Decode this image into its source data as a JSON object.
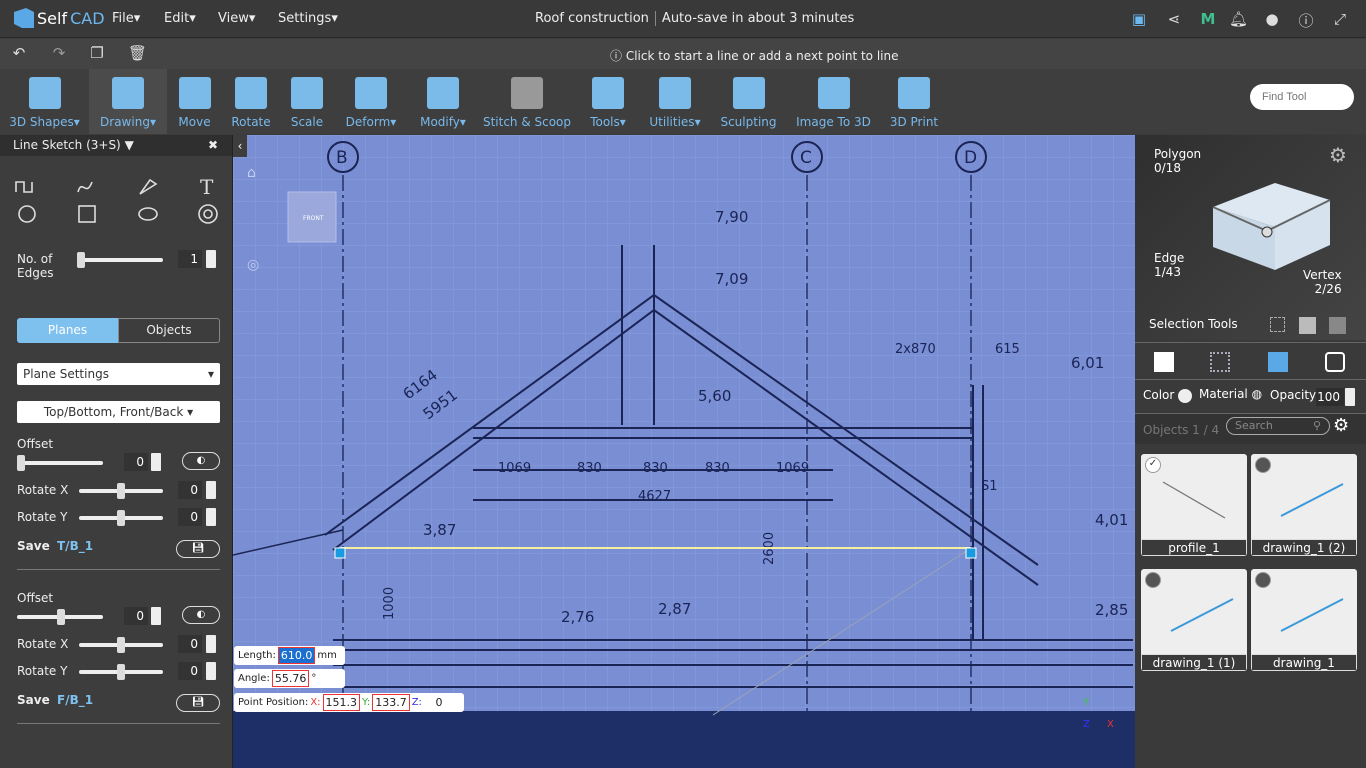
{
  "app": {
    "name_a": "Self",
    "name_b": "CAD",
    "menus": [
      "File",
      "Edit",
      "View",
      "Settings"
    ],
    "doc_title": "Roof construction",
    "autosave": "Auto-save in about 3 minutes"
  },
  "header_icons": [
    "save-icon",
    "share-icon",
    "m-icon",
    "bell-icon",
    "user-icon",
    "info-icon",
    "fullscreen-icon"
  ],
  "hint": "Click to start a line or add a next point to line",
  "toolbar": [
    {
      "label": "3D Shapes",
      "dropdown": true
    },
    {
      "label": "Drawing",
      "dropdown": true,
      "active": true
    },
    {
      "label": "Move"
    },
    {
      "label": "Rotate"
    },
    {
      "label": "Scale"
    },
    {
      "label": "Deform",
      "dropdown": true
    },
    {
      "label": "Modify",
      "dropdown": true
    },
    {
      "label": "Stitch & Scoop"
    },
    {
      "label": "Tools",
      "dropdown": true
    },
    {
      "label": "Utilities",
      "dropdown": true
    },
    {
      "label": "Sculpting"
    },
    {
      "label": "Image To 3D"
    },
    {
      "label": "3D Print"
    }
  ],
  "find_tool_placeholder": "Find Tool",
  "left": {
    "title": "Line Sketch (3+S)",
    "edges_label": "No. of Edges",
    "edges_value": "1",
    "tabs": [
      "Planes",
      "Objects"
    ],
    "plane_settings": "Plane Settings",
    "plane_mode": "Top/Bottom, Front/Back",
    "group1": {
      "offset_label": "Offset",
      "offset": "0",
      "rotx_label": "Rotate X",
      "rotx": "0",
      "roty_label": "Rotate Y",
      "roty": "0",
      "save_label": "Save",
      "name": "T/B_1"
    },
    "group2": {
      "offset_label": "Offset",
      "offset": "0",
      "rotx_label": "Rotate X",
      "rotx": "0",
      "roty_label": "Rotate Y",
      "roty": "0",
      "save_label": "Save",
      "name": "F/B_1"
    }
  },
  "viewport": {
    "cube_face": "FRONT",
    "grid_labels": [
      "B",
      "C",
      "D"
    ],
    "dims": [
      "7,90",
      "7,09",
      "6164",
      "5951",
      "5,60",
      "1069",
      "830",
      "830",
      "830",
      "1069",
      "4627",
      "2x870",
      "615",
      "6,01",
      "S1",
      "3,87",
      "4,01",
      "2600",
      "1000",
      "2,76",
      "2,87",
      "2,85"
    ],
    "length_label": "Length:",
    "length": "610.0",
    "length_unit": "mm",
    "angle_label": "Angle:",
    "angle": "55.76",
    "angle_unit": "°",
    "point_label": "Point Position:",
    "x_label": "X:",
    "x": "151.3",
    "y_label": "Y:",
    "y": "133.7",
    "z_label": "Z:",
    "z": "0",
    "axes": [
      "Y",
      "Z",
      "X"
    ]
  },
  "right": {
    "polygon_label": "Polygon",
    "polygon": "0/18",
    "edge_label": "Edge",
    "edge": "1/43",
    "vertex_label": "Vertex",
    "vertex": "2/26",
    "selection_tools": "Selection Tools",
    "color_label": "Color",
    "material_label": "Material",
    "opacity_label": "Opacity",
    "opacity": "100",
    "objects_label": "Objects 1 / 4",
    "search_placeholder": "Search",
    "objects": [
      {
        "name": "profile_1",
        "checked": true
      },
      {
        "name": "drawing_1 (2)"
      },
      {
        "name": "drawing_1 (1)"
      },
      {
        "name": "drawing_1"
      }
    ]
  },
  "colors": {
    "accent": "#78b9ec",
    "canvas": "#7a8ed3",
    "panel": "#3d3d3d",
    "sketch_line": "#f5f0a0"
  }
}
